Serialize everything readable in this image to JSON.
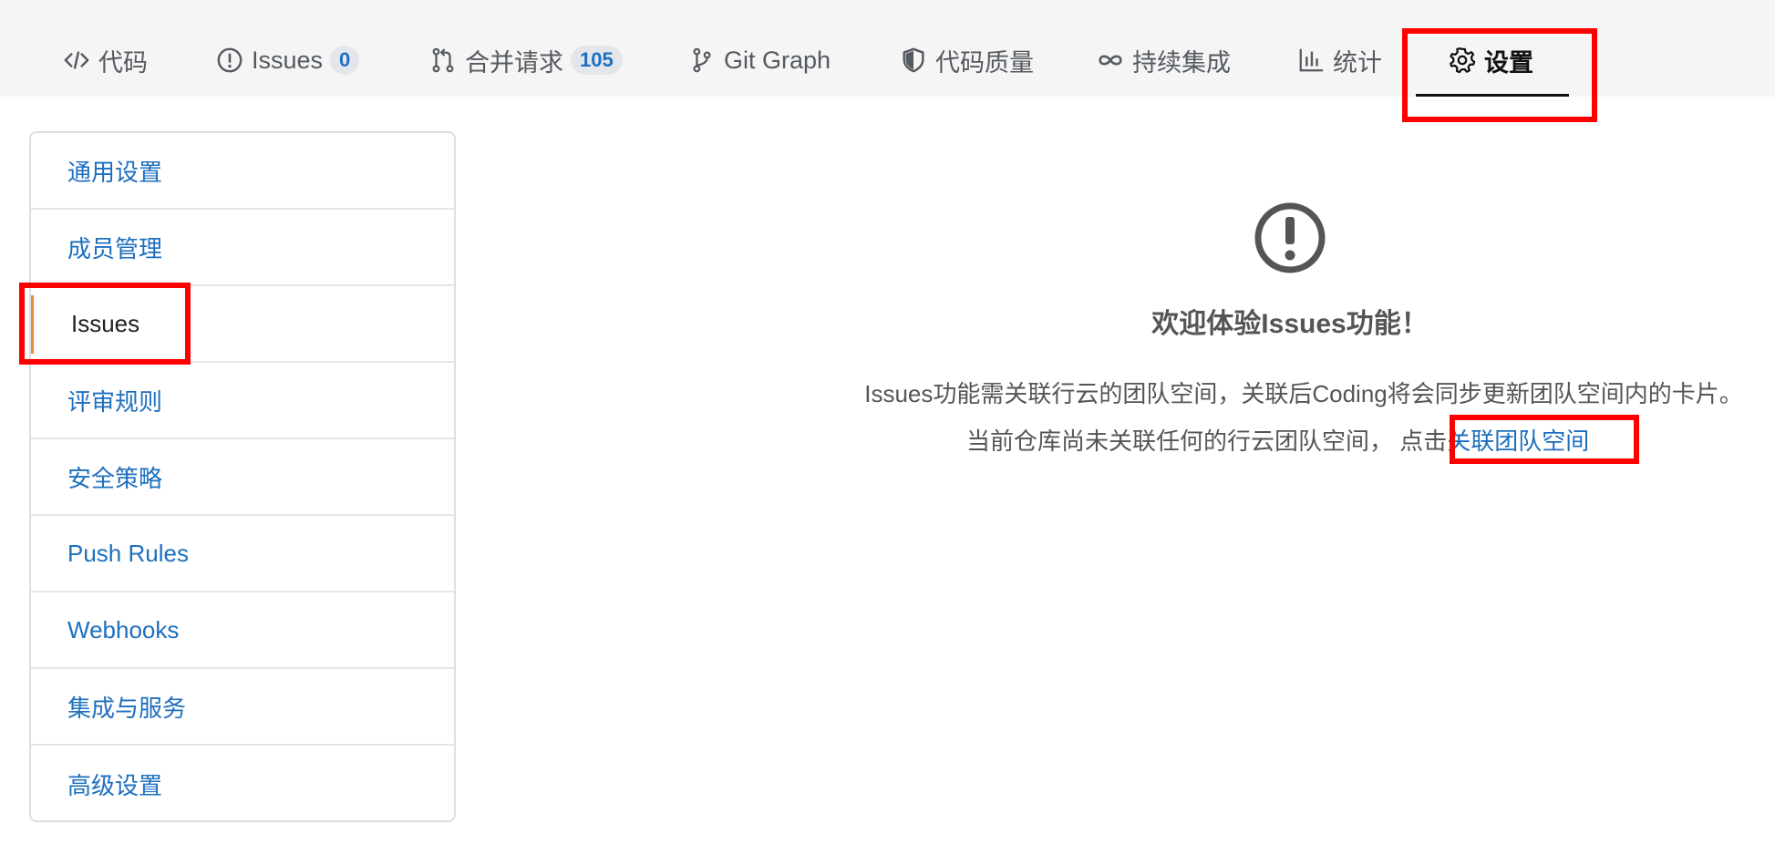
{
  "tabs": [
    {
      "key": "code",
      "label": "代码",
      "icon": "code-icon"
    },
    {
      "key": "issues",
      "label": "Issues",
      "icon": "exclamation-circle-icon",
      "badge": "0"
    },
    {
      "key": "merge",
      "label": "合并请求",
      "icon": "merge-request-icon",
      "badge": "105"
    },
    {
      "key": "graph",
      "label": "Git Graph",
      "icon": "git-branch-icon"
    },
    {
      "key": "quality",
      "label": "代码质量",
      "icon": "shield-icon"
    },
    {
      "key": "ci",
      "label": "持续集成",
      "icon": "infinity-icon"
    },
    {
      "key": "stats",
      "label": "统计",
      "icon": "bar-chart-icon"
    },
    {
      "key": "settings",
      "label": "设置",
      "icon": "gear-icon",
      "active": true
    }
  ],
  "sidebar": {
    "items": [
      {
        "label": "通用设置"
      },
      {
        "label": "成员管理"
      },
      {
        "label": "Issues",
        "active": true
      },
      {
        "label": "评审规则"
      },
      {
        "label": "安全策略"
      },
      {
        "label": "Push Rules"
      },
      {
        "label": "Webhooks"
      },
      {
        "label": "集成与服务"
      },
      {
        "label": "高级设置"
      }
    ]
  },
  "main": {
    "icon": "exclamation-circle-icon",
    "welcome": "欢迎体验Issues功能！",
    "description": "Issues功能需关联行云的团队空间，关联后Coding将会同步更新团队空间内的卡片。",
    "notice_prefix": "当前仓库尚未关联任何的行云团队空间，  点击",
    "link_label": "关联团队空间"
  },
  "colors": {
    "link": "#1e6fbf",
    "highlight": "#ff0000",
    "active_marker": "#e88b2a"
  }
}
